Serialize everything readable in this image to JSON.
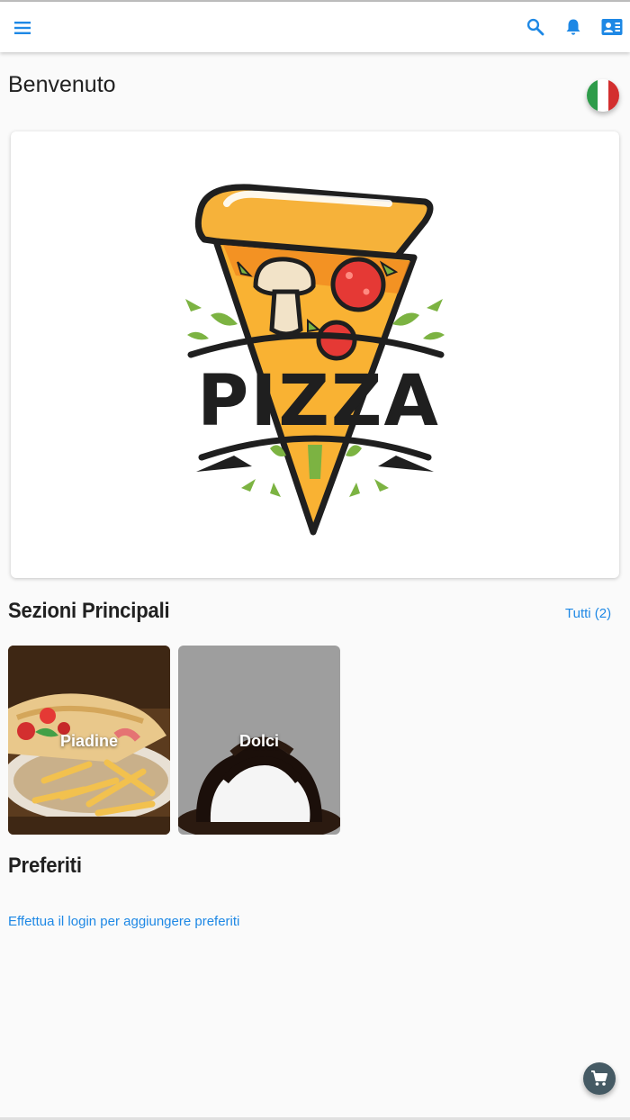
{
  "colors": {
    "accent": "#1e88e5",
    "fab": "#455a64",
    "flag": [
      "#2e9c4a",
      "#ffffff",
      "#d32f2f"
    ]
  },
  "header": {
    "icons": [
      "menu-icon",
      "search-icon",
      "bell-icon",
      "contact-card-icon"
    ]
  },
  "welcome": "Benvenuto",
  "language_flag": "italian-flag-icon",
  "banner": {
    "logo_text": "PIZZA"
  },
  "main_sections": {
    "title": "Sezioni Principali",
    "see_all": "Tutti (2)",
    "items": [
      {
        "label": "Piadine"
      },
      {
        "label": "Dolci"
      }
    ]
  },
  "favorites": {
    "title": "Preferiti",
    "login_prompt": "Effettua il login per aggiungere preferiti"
  },
  "cart_icon": "cart-icon"
}
